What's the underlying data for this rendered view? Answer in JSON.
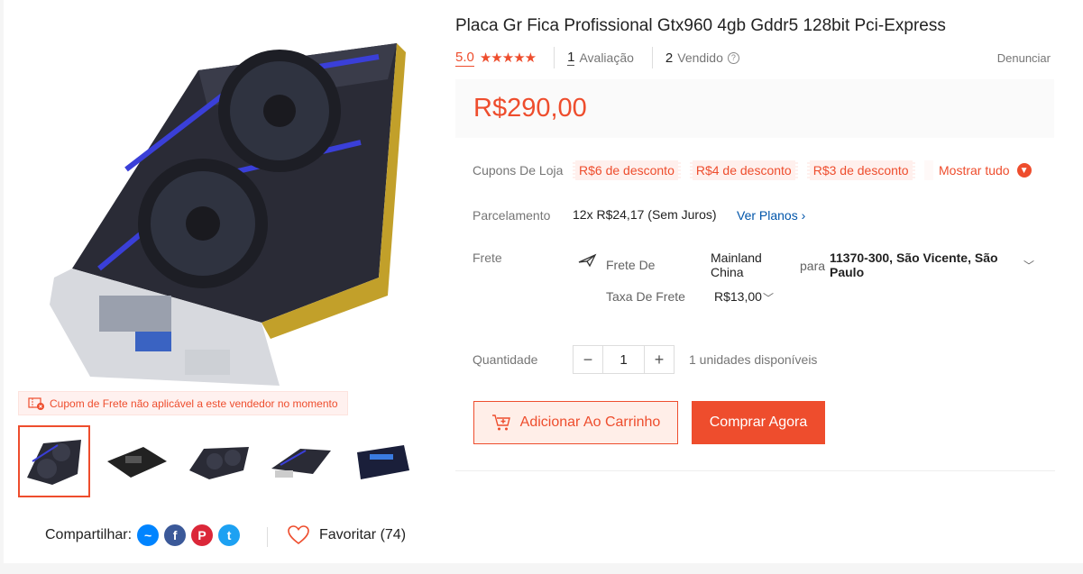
{
  "product": {
    "title": "Placa Gr Fica Profissional Gtx960 4gb Gddr5 128bit Pci-Express",
    "rating": "5.0",
    "stars": "★★★★★",
    "reviews_count": "1",
    "reviews_label": "Avaliação",
    "sold_count": "2",
    "sold_label": "Vendido",
    "report_label": "Denunciar",
    "price": "R$290,00"
  },
  "coupons": {
    "label": "Cupons De Loja",
    "items": [
      "R$6 de desconto",
      "R$4 de desconto",
      "R$3 de desconto"
    ],
    "show_all": "Mostrar tudo"
  },
  "installments": {
    "label": "Parcelamento",
    "value": "12x R$24,17 (Sem Juros)",
    "link": "Ver Planos"
  },
  "shipping": {
    "label": "Frete",
    "from_label": "Frete De",
    "from_value": "Mainland China",
    "to_label": "para",
    "to_value": "11370-300, São Vicente, São Paulo",
    "fee_label": "Taxa De Frete",
    "fee_value": "R$13,00"
  },
  "quantity": {
    "label": "Quantidade",
    "value": "1",
    "minus": "−",
    "plus": "+",
    "stock": "1 unidades disponíveis"
  },
  "actions": {
    "add_to_cart": "Adicionar Ao Carrinho",
    "buy_now": "Comprar Agora"
  },
  "gallery": {
    "voucher_warning": "Cupom de Frete não aplicável a este vendedor no momento",
    "thumbnail_count": 5
  },
  "social": {
    "share_label": "Compartilhar:",
    "favorite_label": "Favoritar (74)"
  },
  "colors": {
    "accent": "#ee4d2d",
    "link": "#0055aa"
  }
}
